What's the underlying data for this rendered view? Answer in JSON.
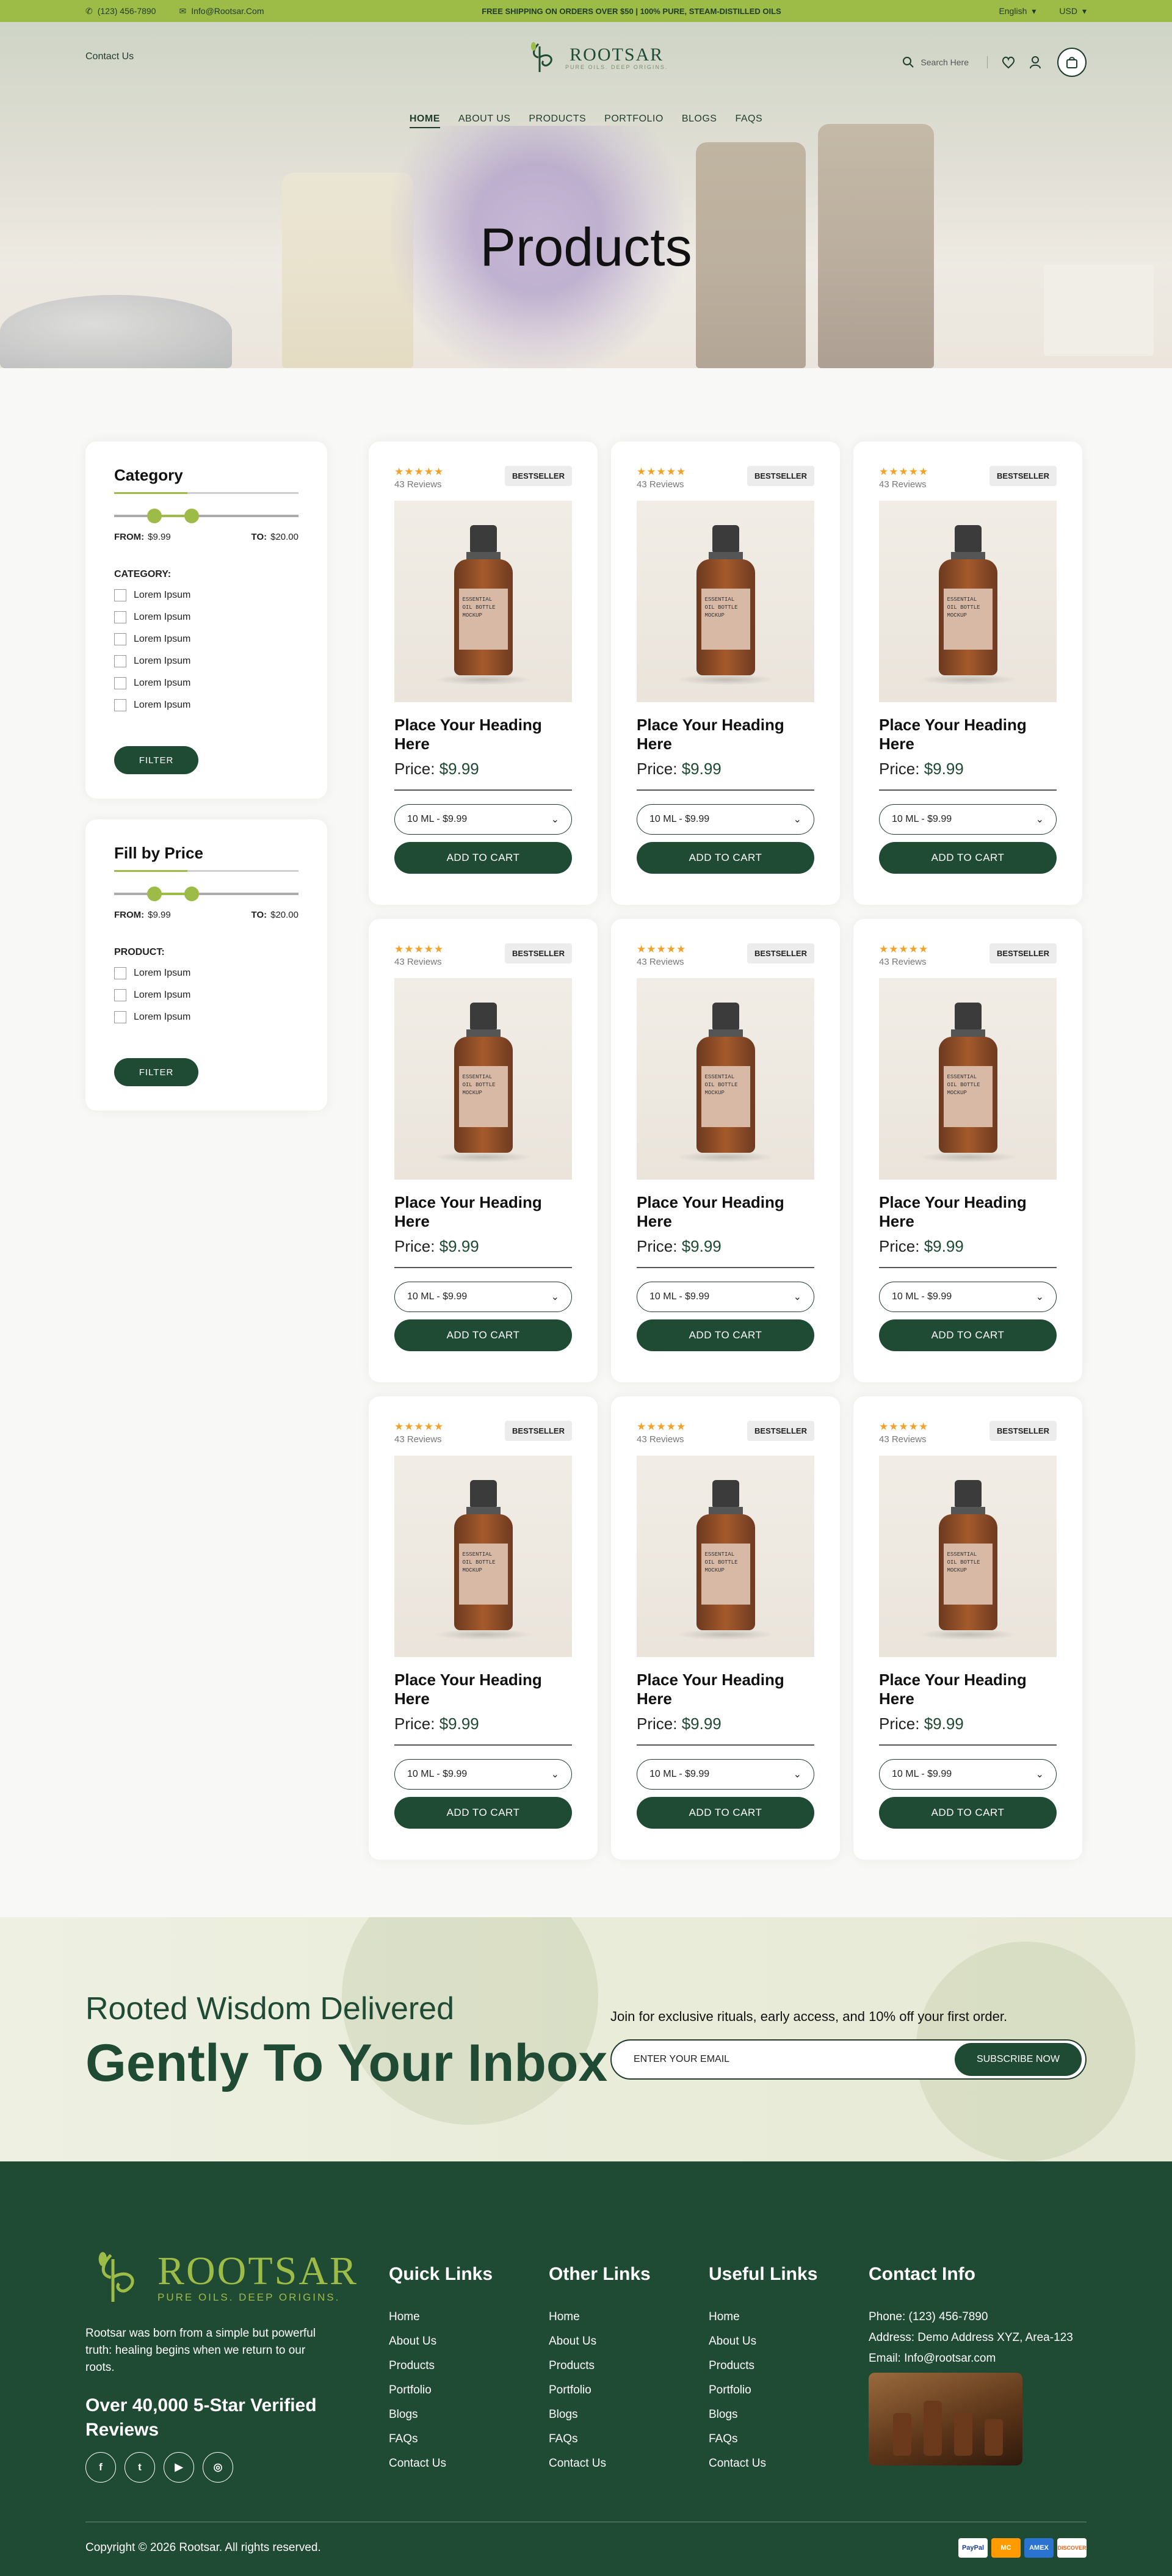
{
  "topbar": {
    "phone": "(123) 456-7890",
    "email": "Info@Rootsar.Com",
    "announcement": "FREE SHIPPING ON ORDERS OVER $50 | 100% PURE, STEAM-DISTILLED OILS",
    "language": "English",
    "currency": "USD"
  },
  "header": {
    "contact": "Contact Us",
    "logo_name": "ROOTSAR",
    "logo_tag": "PURE OILS. DEEP ORIGINS.",
    "search_placeholder": "Search Here"
  },
  "nav": [
    "HOME",
    "ABOUT US",
    "PRODUCTS",
    "PORTFOLIO",
    "BLOGS",
    "FAQS"
  ],
  "hero": {
    "title": "Products"
  },
  "sidebar": {
    "category_panel": {
      "title": "Category",
      "from_label": "FROM:",
      "from_value": "$9.99",
      "to_label": "TO:",
      "to_value": "$20.00",
      "slider": {
        "min": 0.22,
        "max": 0.42
      },
      "section": "CATEGORY:",
      "options": [
        "Lorem Ipsum",
        "Lorem Ipsum",
        "Lorem Ipsum",
        "Lorem Ipsum",
        "Lorem Ipsum",
        "Lorem Ipsum"
      ],
      "button": "FILTER"
    },
    "price_panel": {
      "title": "Fill by Price",
      "from_label": "FROM:",
      "from_value": "$9.99",
      "to_label": "TO:",
      "to_value": "$20.00",
      "slider": {
        "min": 0.22,
        "max": 0.42
      },
      "section": "PRODUCT:",
      "options": [
        "Lorem Ipsum",
        "Lorem Ipsum",
        "Lorem Ipsum"
      ],
      "button": "FILTER"
    }
  },
  "product_template": {
    "stars": "★★★★★",
    "reviews": "43 Reviews",
    "badge": "BESTSELLER",
    "bottle_label": "ESSENTIAL OIL BOTTLE MOCKUP",
    "heading": "Place Your Heading Here",
    "price_label": "Price:",
    "price_value": "$9.99",
    "variant": "10 ML - $9.99",
    "button": "ADD TO CART",
    "count": 9
  },
  "newsletter": {
    "line1": "Rooted Wisdom Delivered",
    "line2": "Gently To Your Inbox",
    "join": "Join for exclusive rituals, early access, and 10% off your first order.",
    "email_placeholder": "ENTER YOUR EMAIL",
    "button": "SUBSCRIBE NOW"
  },
  "footer": {
    "logo_name": "ROOTSAR",
    "logo_tag": "PURE OILS. DEEP ORIGINS.",
    "about": "Rootsar was born from a simple but powerful truth: healing begins when we return to our roots.",
    "reviews": "Over 40,000 5-Star Verified Reviews",
    "socials": [
      "f",
      "t",
      "▶",
      "◎"
    ],
    "quick_links": {
      "title": "Quick Links",
      "items": [
        "Home",
        "About Us",
        "Products",
        "Portfolio",
        "Blogs",
        "FAQs",
        "Contact Us"
      ]
    },
    "other_links": {
      "title": "Other Links",
      "items": [
        "Home",
        "About Us",
        "Products",
        "Portfolio",
        "Blogs",
        "FAQs",
        "Contact Us"
      ]
    },
    "useful_links": {
      "title": "Useful Links",
      "items": [
        "Home",
        "About Us",
        "Products",
        "Portfolio",
        "Blogs",
        "FAQs",
        "Contact Us"
      ]
    },
    "contact": {
      "title": "Contact Info",
      "phone": "Phone: (123) 456-7890",
      "address": "Address: Demo Address XYZ, Area-123",
      "email": "Email: Info@rootsar.com"
    },
    "copyright": "Copyright © 2026 Rootsar. All rights reserved.",
    "payments": [
      "PayPal",
      "MC",
      "AMEX",
      "DISCOVER"
    ]
  },
  "colors": {
    "brand_green": "#1f4a34",
    "accent_lime": "#9dbb47",
    "star": "#f2a22b"
  }
}
